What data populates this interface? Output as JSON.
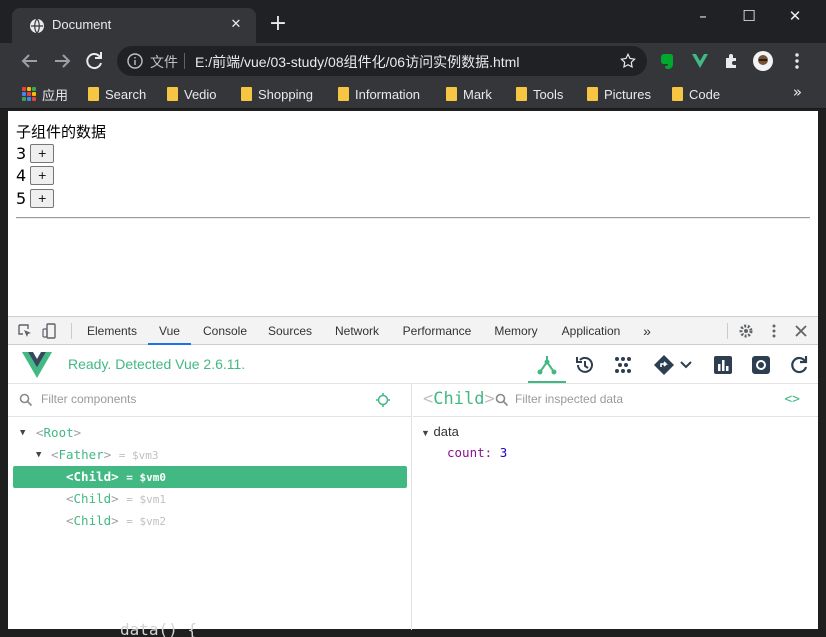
{
  "browser": {
    "tab_title": "Document",
    "tab_close": "✕",
    "new_tab": "+",
    "window_controls": {
      "minimize": "–",
      "maximize": "☐",
      "close": "✕"
    },
    "omnibox": {
      "prefix": "文件",
      "url": "E:/前端/vue/03-study/08组件化/06访问实例数据.html"
    },
    "bookmarks": [
      {
        "label": "应用",
        "icon": "apps-grid-icon"
      },
      {
        "label": "Search",
        "icon": "folder-icon"
      },
      {
        "label": "Vedio",
        "icon": "folder-icon"
      },
      {
        "label": "Shopping",
        "icon": "folder-icon"
      },
      {
        "label": "Information",
        "icon": "folder-icon"
      },
      {
        "label": "Mark",
        "icon": "folder-icon"
      },
      {
        "label": "Tools",
        "icon": "folder-icon"
      },
      {
        "label": "Pictures",
        "icon": "folder-icon"
      },
      {
        "label": "Code",
        "icon": "folder-icon"
      }
    ],
    "bookmarks_more": "»"
  },
  "page": {
    "heading": "子组件的数据",
    "rows": [
      {
        "value": "3",
        "button": "+"
      },
      {
        "value": "4",
        "button": "+"
      },
      {
        "value": "5",
        "button": "+"
      }
    ]
  },
  "devtools": {
    "tabs": [
      "Elements",
      "Vue",
      "Console",
      "Sources",
      "Network",
      "Performance",
      "Memory",
      "Application"
    ],
    "active_tab": "Vue",
    "more_tabs": "»",
    "vue": {
      "status": "Ready. Detected Vue 2.6.11.",
      "filter_components_placeholder": "Filter components",
      "filter_data_placeholder": "Filter inspected data",
      "selected_component": {
        "open": "<",
        "name": "Child",
        "close": ">"
      },
      "code_icon": "<>",
      "tree": [
        {
          "open": "<",
          "name": "Root",
          "close": ">",
          "ref": "",
          "expanded": true,
          "selected": false
        },
        {
          "open": "<",
          "name": "Father",
          "close": ">",
          "ref": "= $vm3",
          "expanded": true,
          "selected": false
        },
        {
          "open": "<",
          "name": "Child",
          "close": ">",
          "ref": "= $vm0",
          "expanded": false,
          "selected": true
        },
        {
          "open": "<",
          "name": "Child",
          "close": ">",
          "ref": "= $vm1",
          "expanded": false,
          "selected": false
        },
        {
          "open": "<",
          "name": "Child",
          "close": ">",
          "ref": "= $vm2",
          "expanded": false,
          "selected": false
        }
      ],
      "data_section": "data",
      "data_props": [
        {
          "key": "count:",
          "value": "3"
        }
      ]
    }
  },
  "below_text": "data() {",
  "colors": {
    "vue_green": "#42b983",
    "chrome_dark": "#202124",
    "chrome_toolbar": "#35363a",
    "devtools_blue": "#1a73e8"
  }
}
